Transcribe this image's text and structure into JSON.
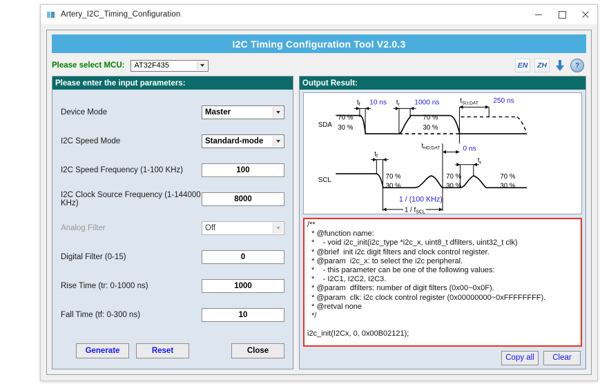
{
  "window": {
    "title": "Artery_I2C_Timing_Configuration",
    "icon": "app-icon",
    "controls": {
      "minimize": "—",
      "maximize": "☐",
      "close": "✕"
    }
  },
  "banner": {
    "title": "I2C Timing Configuration Tool V2.0.3",
    "bg": "#4badde"
  },
  "mcu": {
    "label": "Please select MCU:",
    "value": "AT32F435",
    "options": [
      "AT32F435"
    ],
    "label_color": "#008000"
  },
  "header_icons": {
    "lang_en": "EN",
    "lang_zh": "ZH",
    "download": "download-arrow-icon",
    "help": "?"
  },
  "left_panel": {
    "header": "Please enter the input parameters:",
    "fields": [
      {
        "label": "Device Mode",
        "value": "Master",
        "type": "combo",
        "disabled": false
      },
      {
        "label": "I2C Speed Mode",
        "value": "Standard-mode",
        "type": "combo",
        "disabled": false
      },
      {
        "label": "I2C Speed Frequency (1-100 KHz)",
        "value": "100",
        "type": "text",
        "disabled": false
      },
      {
        "label": "I2C Clock Source Frequency (1-144000 KHz)",
        "value": "8000",
        "type": "text",
        "disabled": false
      },
      {
        "label": "Analog Filter",
        "value": "Off",
        "type": "combo",
        "disabled": true
      },
      {
        "label": "Digital Filter (0-15)",
        "value": "0",
        "type": "text",
        "disabled": false
      },
      {
        "label": "Rise Time (tr: 0-1000 ns)",
        "value": "1000",
        "type": "text",
        "disabled": false
      },
      {
        "label": "Fall Time (tf: 0-300 ns)",
        "value": "10",
        "type": "text",
        "disabled": false
      }
    ],
    "buttons": {
      "generate": "Generate",
      "reset": "Reset",
      "close": "Close"
    }
  },
  "right_panel": {
    "header": "Output Result:",
    "diagram": {
      "signals": [
        "SDA",
        "SCL"
      ],
      "levels": [
        "70 %",
        "30 %"
      ],
      "annotations": [
        {
          "symbol": "t",
          "sub": "f",
          "value": "10 ns"
        },
        {
          "symbol": "t",
          "sub": "r",
          "value": "1000 ns"
        },
        {
          "symbol": "t",
          "sub": "SU;DAT",
          "value": "250 ns"
        },
        {
          "symbol": "t",
          "sub": "HD;DAT",
          "value": "0 ns"
        },
        {
          "symbol": "t",
          "sub": "f",
          "value": ""
        },
        {
          "symbol": "t",
          "sub": "r",
          "value": ""
        }
      ],
      "period_value": "1 / (100 KHz)",
      "period_label": "1 / f",
      "period_label_sub": "SCL",
      "accent_color": "#2020ee"
    },
    "code_lines": [
      "/**",
      "  * @function name:",
      "  *    - void i2c_init(i2c_type *i2c_x, uint8_t dfilters, uint32_t clk)",
      "  * @brief  init i2c digit filters and clock control register.",
      "  * @param  i2c_x: to select the i2c peripheral.",
      "  *    - this parameter can be one of the following values:",
      "  *    - I2C1, I2C2, I2C3.",
      "  * @param  dfilters: number of digit filters (0x00~0x0F).",
      "  * @param  clk: i2c clock control register (0x00000000~0xFFFFFFFF).",
      "  * @retval none",
      "  */",
      "",
      "i2c_init(I2Cx, 0, 0x00B02121);"
    ],
    "buttons": {
      "copy_all": "Copy all",
      "clear": "Clear"
    },
    "border_color": "#e8332a"
  }
}
